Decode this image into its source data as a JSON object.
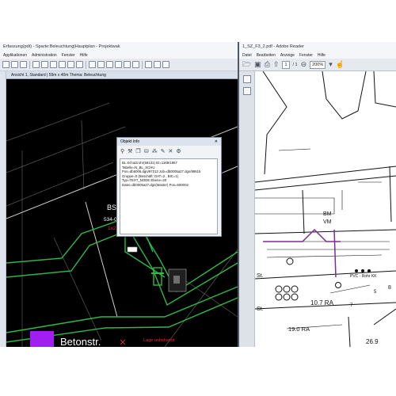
{
  "left_app": {
    "title": "Erfassung(pdt) - Sparte:Beleuchtung|Hauptplan - Projektwak",
    "menu": [
      "Applikationen",
      "Administration",
      "Fenster",
      "Hilfe"
    ],
    "view_title": "Ansicht 1, Standard | 59m x 40m Thema: Beleuchtung",
    "cad_labels": {
      "bs": "BS",
      "bs_id": "534-0002",
      "bs_sub": "1x25/25",
      "street": "Betonstr.",
      "lage": "Lage unbekannt"
    },
    "object_info": {
      "title": "Objekt Info",
      "lines": [
        "BL Schutzrohr(59131)  ID=1169/1967",
        "Tabelle=N_BL_SCHU",
        "Pos=db6006.dgn/97213  Job=db0005a27.dgn/98615",
        "Gruppe=0 (Beschäft: DAT=2 , BIC=1)",
        "Typ=TEXT_NODE  Ebene=20",
        "Datei=db0005a27.dgn(Master)  Pos=600002"
      ]
    }
  },
  "right_app": {
    "title": "1_SZ_F3_2.pdf - Adobe Reader",
    "menu": [
      "Datei",
      "Bearbeiten",
      "Anzeige",
      "Fenster",
      "Hilfe"
    ],
    "page_current": "1",
    "page_total": "/ 1",
    "zoom": "200%",
    "pdf_labels": {
      "bm": "BM",
      "vm": "VM",
      "pvc": "PVC - Rohr KK",
      "st1": "St.",
      "st2": "St.",
      "d1": "10.7 RA",
      "d2": "19.0 RA",
      "d3": "26.9",
      "n8": "8",
      "n7": "7",
      "n5": "5"
    }
  },
  "colors": {
    "cad_background": "#000000",
    "cad_green": "#2db84a",
    "cad_magenta": "#a01ef0",
    "cad_red": "#d8323c",
    "pdf_purple": "#7a2f8f"
  }
}
